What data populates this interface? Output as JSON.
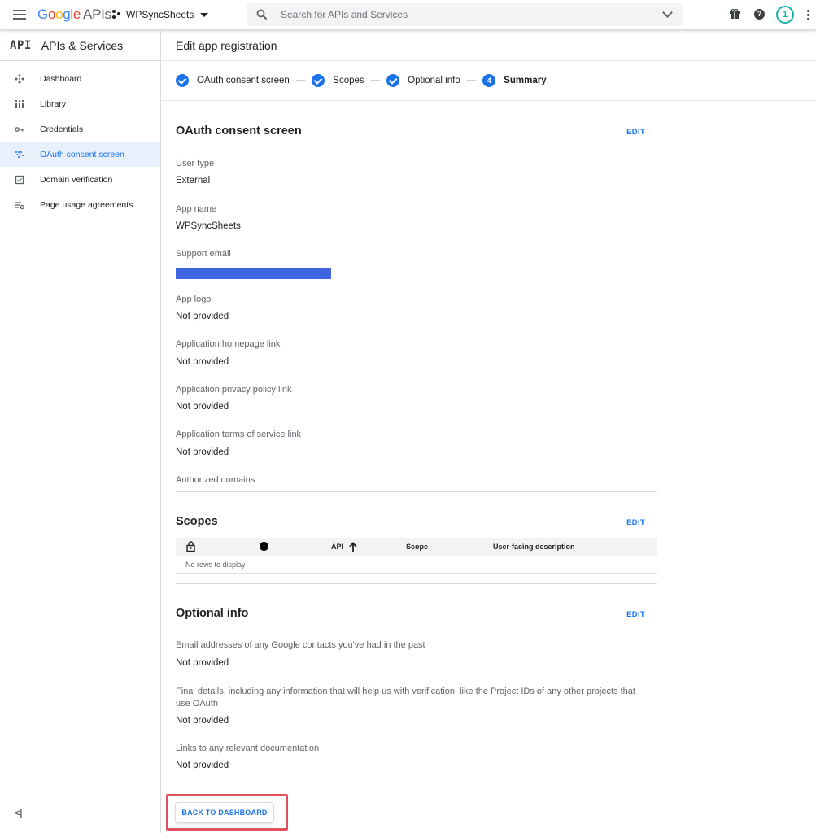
{
  "topbar": {
    "logo_google": "Google",
    "logo_apis": "APIs",
    "project_name": "WPSyncSheets",
    "search_placeholder": "Search for APIs and Services",
    "notification_count": "1",
    "help_glyph": "?"
  },
  "sidebar": {
    "badge": "API",
    "title": "APIs & Services",
    "items": [
      {
        "label": "Dashboard",
        "icon": "dashboard-icon"
      },
      {
        "label": "Library",
        "icon": "library-icon"
      },
      {
        "label": "Credentials",
        "icon": "key-icon"
      },
      {
        "label": "OAuth consent screen",
        "icon": "consent-icon",
        "active": true
      },
      {
        "label": "Domain verification",
        "icon": "checkbox-icon"
      },
      {
        "label": "Page usage agreements",
        "icon": "settings-list-icon"
      }
    ],
    "collapse_glyph": "<|"
  },
  "main": {
    "page_title": "Edit app registration",
    "steps": [
      {
        "label": "OAuth consent screen",
        "state": "done"
      },
      {
        "label": "Scopes",
        "state": "done"
      },
      {
        "label": "Optional info",
        "state": "done"
      },
      {
        "label": "Summary",
        "state": "current",
        "number": "4"
      }
    ],
    "step_separator": "—",
    "edit_label": "EDIT",
    "oauth": {
      "title": "OAuth consent screen",
      "fields": [
        {
          "label": "User type",
          "value": "External"
        },
        {
          "label": "App name",
          "value": "WPSyncSheets"
        },
        {
          "label": "Support email",
          "value": ""
        },
        {
          "label": "App logo",
          "value": "Not provided"
        },
        {
          "label": "Application homepage link",
          "value": "Not provided"
        },
        {
          "label": "Application privacy policy link",
          "value": "Not provided"
        },
        {
          "label": "Application terms of service link",
          "value": "Not provided"
        }
      ],
      "authorized_domains_label": "Authorized domains"
    },
    "scopes": {
      "title": "Scopes",
      "columns": [
        "API",
        "Scope",
        "User-facing description"
      ],
      "empty_text": "No rows to display"
    },
    "optional": {
      "title": "Optional info",
      "fields": [
        {
          "label": "Email addresses of any Google contacts you've had in the past",
          "value": "Not provided"
        },
        {
          "label": "Final details, including any information that will help us with verification, like the Project IDs of any other projects that use OAuth",
          "value": "Not provided"
        },
        {
          "label": "Links to any relevant documentation",
          "value": "Not provided"
        }
      ]
    },
    "back_button": "BACK TO DASHBOARD"
  },
  "colors": {
    "accent": "#1a73e8",
    "highlight": "#e05260",
    "redaction": "#3f66e0"
  }
}
